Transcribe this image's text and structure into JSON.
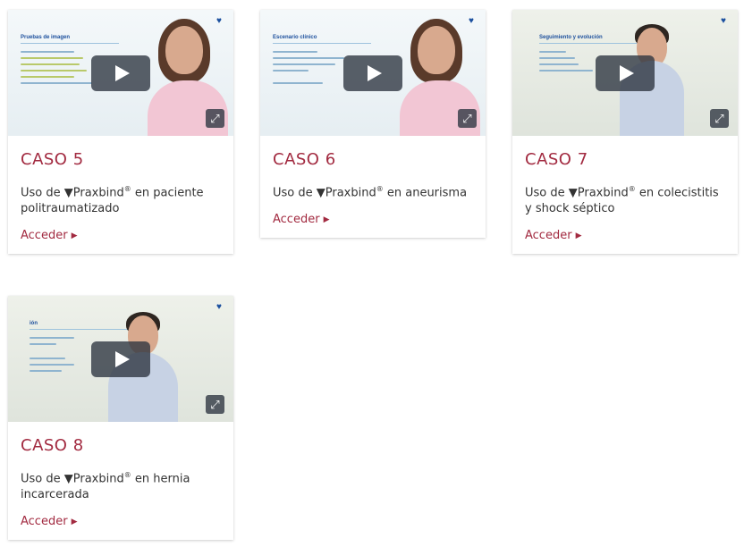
{
  "cards": [
    {
      "caso": "CASO 5",
      "desc_pre": "Uso de ▼Praxbind",
      "reg": "®",
      "desc_post": " en paciente politraumatizado",
      "link": "Acceder",
      "slide_title": "Pruebas de imagen"
    },
    {
      "caso": "CASO 6",
      "desc_pre": "Uso de ▼Praxbind",
      "reg": "®",
      "desc_post": " en aneurisma",
      "link": "Acceder",
      "slide_title": "Escenario clínico"
    },
    {
      "caso": "CASO 7",
      "desc_pre": "Uso de ▼Praxbind",
      "reg": "®",
      "desc_post": " en colecistitis y shock séptico",
      "link": "Acceder",
      "slide_title": "Seguimiento y evolución"
    },
    {
      "caso": "CASO 8",
      "desc_pre": "Uso de ▼Praxbind",
      "reg": "®",
      "desc_post": " en hernia incarcerada",
      "link": "Acceder",
      "slide_title": "ión"
    }
  ],
  "icons": {
    "play": "play-icon",
    "fullscreen": "fullscreen-icon",
    "brand": "heart-logo-icon",
    "link_caret": "caret-right-icon"
  },
  "colors": {
    "accent": "#a22a40",
    "text": "#333333",
    "overlay": "#2b333f",
    "brand": "#1a4f9e"
  }
}
